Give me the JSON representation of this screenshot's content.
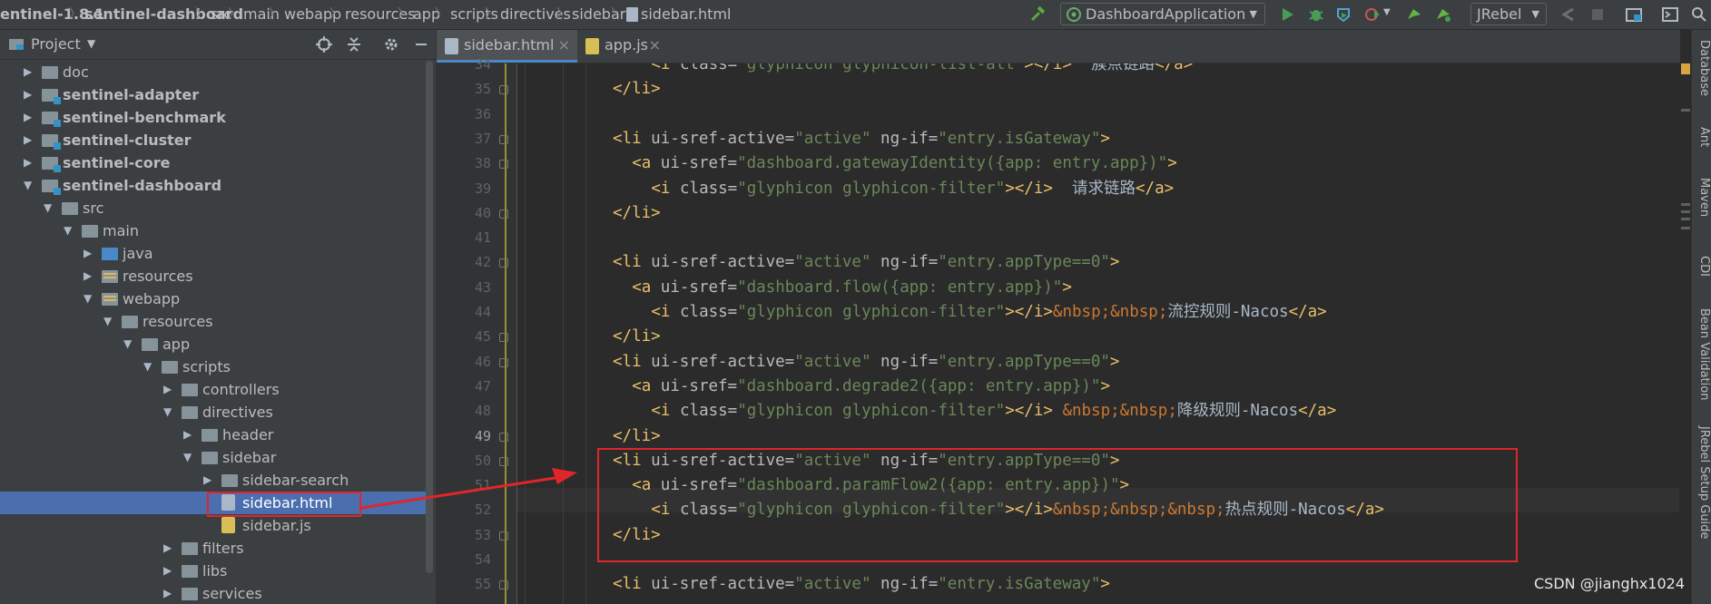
{
  "breadcrumbs": [
    "entinel-1.8.1",
    "sentinel-dashboard",
    "src",
    "main",
    "webapp",
    "resources",
    "app",
    "scripts",
    "directives",
    "sidebar",
    "sidebar.html"
  ],
  "run_config": "DashboardApplication",
  "jrebel": "JRebel",
  "project_panel": {
    "title": "Project"
  },
  "tree": [
    {
      "label": "doc",
      "depth": 1,
      "expanded": false,
      "icon": "folder",
      "bold": false
    },
    {
      "label": "sentinel-adapter",
      "depth": 1,
      "expanded": false,
      "icon": "module",
      "bold": true
    },
    {
      "label": "sentinel-benchmark",
      "depth": 1,
      "expanded": false,
      "icon": "module",
      "bold": true
    },
    {
      "label": "sentinel-cluster",
      "depth": 1,
      "expanded": false,
      "icon": "module",
      "bold": true
    },
    {
      "label": "sentinel-core",
      "depth": 1,
      "expanded": false,
      "icon": "module",
      "bold": true
    },
    {
      "label": "sentinel-dashboard",
      "depth": 1,
      "expanded": true,
      "icon": "module",
      "bold": true
    },
    {
      "label": "src",
      "depth": 2,
      "expanded": true,
      "icon": "folder",
      "bold": false
    },
    {
      "label": "main",
      "depth": 3,
      "expanded": true,
      "icon": "folder",
      "bold": false
    },
    {
      "label": "java",
      "depth": 4,
      "expanded": false,
      "icon": "source-folder",
      "bold": false
    },
    {
      "label": "resources",
      "depth": 4,
      "expanded": false,
      "icon": "resources-folder",
      "bold": false
    },
    {
      "label": "webapp",
      "depth": 4,
      "expanded": true,
      "icon": "web-folder",
      "bold": false
    },
    {
      "label": "resources",
      "depth": 5,
      "expanded": true,
      "icon": "folder",
      "bold": false
    },
    {
      "label": "app",
      "depth": 6,
      "expanded": true,
      "icon": "folder",
      "bold": false
    },
    {
      "label": "scripts",
      "depth": 7,
      "expanded": true,
      "icon": "folder",
      "bold": false
    },
    {
      "label": "controllers",
      "depth": 8,
      "expanded": false,
      "icon": "folder",
      "bold": false
    },
    {
      "label": "directives",
      "depth": 8,
      "expanded": true,
      "icon": "folder",
      "bold": false
    },
    {
      "label": "header",
      "depth": 9,
      "expanded": false,
      "icon": "folder",
      "bold": false
    },
    {
      "label": "sidebar",
      "depth": 9,
      "expanded": true,
      "icon": "folder",
      "bold": false
    },
    {
      "label": "sidebar-search",
      "depth": 10,
      "expanded": false,
      "icon": "folder",
      "bold": false
    },
    {
      "label": "sidebar.html",
      "depth": 10,
      "expanded": null,
      "icon": "html-file",
      "bold": false,
      "selected": true
    },
    {
      "label": "sidebar.js",
      "depth": 10,
      "expanded": null,
      "icon": "js-file",
      "bold": false
    },
    {
      "label": "filters",
      "depth": 8,
      "expanded": false,
      "icon": "folder",
      "bold": false
    },
    {
      "label": "libs",
      "depth": 8,
      "expanded": false,
      "icon": "folder",
      "bold": false
    },
    {
      "label": "services",
      "depth": 8,
      "expanded": false,
      "icon": "folder",
      "bold": false
    }
  ],
  "tabs": [
    {
      "label": "sidebar.html",
      "active": true,
      "icon": "html-file"
    },
    {
      "label": "app.js",
      "active": false,
      "icon": "js-file"
    }
  ],
  "editor": {
    "current_line": 49,
    "lines": [
      {
        "n": 34,
        "indent": 4,
        "tokens": [
          [
            "tg",
            "<i "
          ],
          [
            "at",
            "class="
          ],
          [
            "vl",
            "\"glyphicon glyphicon-list-alt\""
          ],
          [
            "tg",
            "></i>"
          ],
          [
            "tx",
            "  簇点链路"
          ],
          [
            "tg",
            "</a>"
          ]
        ]
      },
      {
        "n": 35,
        "indent": 0,
        "tokens": [
          [
            "tg",
            "</li>"
          ]
        ]
      },
      {
        "n": 36,
        "indent": 0,
        "tokens": []
      },
      {
        "n": 37,
        "indent": 0,
        "tokens": [
          [
            "tg",
            "<li "
          ],
          [
            "at",
            "ui-sref-active="
          ],
          [
            "vl",
            "\"active\" "
          ],
          [
            "at",
            "ng-if="
          ],
          [
            "vl",
            "\"entry.isGateway\""
          ],
          [
            "tg",
            ">"
          ]
        ]
      },
      {
        "n": 38,
        "indent": 2,
        "tokens": [
          [
            "tg",
            "<a "
          ],
          [
            "at",
            "ui-sref="
          ],
          [
            "vl",
            "\"dashboard.gatewayIdentity({app: entry.app})\""
          ],
          [
            "tg",
            ">"
          ]
        ]
      },
      {
        "n": 39,
        "indent": 4,
        "tokens": [
          [
            "tg",
            "<i "
          ],
          [
            "at",
            "class="
          ],
          [
            "vl",
            "\"glyphicon glyphicon-filter\""
          ],
          [
            "tg",
            "></i>"
          ],
          [
            "tx",
            "  请求链路"
          ],
          [
            "tg",
            "</a>"
          ]
        ]
      },
      {
        "n": 40,
        "indent": 0,
        "tokens": [
          [
            "tg",
            "</li>"
          ]
        ]
      },
      {
        "n": 41,
        "indent": 0,
        "tokens": []
      },
      {
        "n": 42,
        "indent": 0,
        "tokens": [
          [
            "tg",
            "<li "
          ],
          [
            "at",
            "ui-sref-active="
          ],
          [
            "vl",
            "\"active\" "
          ],
          [
            "at",
            "ng-if="
          ],
          [
            "vl",
            "\"entry.appType==0\""
          ],
          [
            "tg",
            ">"
          ]
        ]
      },
      {
        "n": 43,
        "indent": 2,
        "tokens": [
          [
            "tg",
            "<a "
          ],
          [
            "at",
            "ui-sref="
          ],
          [
            "vl",
            "\"dashboard.flow({app: entry.app})\""
          ],
          [
            "tg",
            ">"
          ]
        ]
      },
      {
        "n": 44,
        "indent": 4,
        "tokens": [
          [
            "tg",
            "<i "
          ],
          [
            "at",
            "class="
          ],
          [
            "vl",
            "\"glyphicon glyphicon-filter\""
          ],
          [
            "tg",
            "></i>"
          ],
          [
            "ent",
            "&nbsp;&nbsp;"
          ],
          [
            "tx",
            "流控规则-Nacos"
          ],
          [
            "tg",
            "</a>"
          ]
        ]
      },
      {
        "n": 45,
        "indent": 0,
        "tokens": [
          [
            "tg",
            "</li>"
          ]
        ]
      },
      {
        "n": 46,
        "indent": 0,
        "tokens": [
          [
            "tg",
            "<li "
          ],
          [
            "at",
            "ui-sref-active="
          ],
          [
            "vl",
            "\"active\" "
          ],
          [
            "at",
            "ng-if="
          ],
          [
            "vl",
            "\"entry.appType==0\""
          ],
          [
            "tg",
            ">"
          ]
        ]
      },
      {
        "n": 47,
        "indent": 2,
        "tokens": [
          [
            "tg",
            "<a "
          ],
          [
            "at",
            "ui-sref="
          ],
          [
            "vl",
            "\"dashboard.degrade2({app: entry.app})\""
          ],
          [
            "tg",
            ">"
          ]
        ]
      },
      {
        "n": 48,
        "indent": 4,
        "tokens": [
          [
            "tg",
            "<i "
          ],
          [
            "at",
            "class="
          ],
          [
            "vl",
            "\"glyphicon glyphicon-filter\""
          ],
          [
            "tg",
            "></i> "
          ],
          [
            "ent",
            "&nbsp;&nbsp;"
          ],
          [
            "tx",
            "降级规则-Nacos"
          ],
          [
            "tg",
            "</a>"
          ]
        ]
      },
      {
        "n": 49,
        "indent": 0,
        "tokens": [
          [
            "tg",
            "</li>"
          ]
        ]
      },
      {
        "n": 50,
        "indent": 0,
        "tokens": [
          [
            "tg",
            "<li "
          ],
          [
            "at",
            "ui-sref-active="
          ],
          [
            "vl",
            "\"active\" "
          ],
          [
            "at",
            "ng-if="
          ],
          [
            "vl",
            "\"entry.appType==0\""
          ],
          [
            "tg",
            ">"
          ]
        ]
      },
      {
        "n": 51,
        "indent": 2,
        "tokens": [
          [
            "tg",
            "<a "
          ],
          [
            "at",
            "ui-sref="
          ],
          [
            "vl",
            "\"dashboard.paramFlow2({app: entry.app})\""
          ],
          [
            "tg",
            ">"
          ]
        ]
      },
      {
        "n": 52,
        "indent": 4,
        "tokens": [
          [
            "tg",
            "<i "
          ],
          [
            "at",
            "class="
          ],
          [
            "vl",
            "\"glyphicon glyphicon-filter\""
          ],
          [
            "tg",
            "></i>"
          ],
          [
            "ent",
            "&nbsp;&nbsp;&nbsp;"
          ],
          [
            "tx",
            "热点规则-Nacos"
          ],
          [
            "tg",
            "</a>"
          ]
        ]
      },
      {
        "n": 53,
        "indent": 0,
        "tokens": [
          [
            "tg",
            "</li>"
          ]
        ]
      },
      {
        "n": 54,
        "indent": 0,
        "tokens": []
      },
      {
        "n": 55,
        "indent": 0,
        "tokens": [
          [
            "tg",
            "<li "
          ],
          [
            "at",
            "ui-sref-active="
          ],
          [
            "vl",
            "\"active\" "
          ],
          [
            "at",
            "ng-if="
          ],
          [
            "vl",
            "\"entry.isGateway\""
          ],
          [
            "tg",
            ">"
          ]
        ]
      }
    ]
  },
  "right_tools": [
    "Database",
    "Ant",
    "Maven",
    "CDI",
    "Bean Validation",
    "JRebel Setup Guide"
  ],
  "watermark": "CSDN @jianghx1024",
  "colors": {
    "selection": "#4b6eaf",
    "annotation": "#e0262a",
    "tag": "#e8bf6a",
    "string": "#6a8759",
    "entity": "#cc7832"
  }
}
